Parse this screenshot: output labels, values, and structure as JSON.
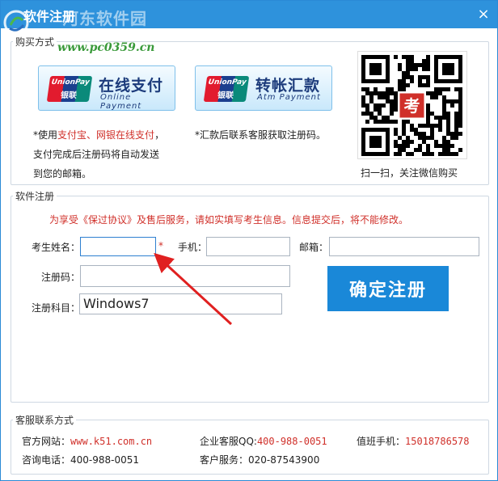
{
  "window": {
    "title": "软件注册",
    "watermark_name": "河东软件园",
    "watermark_url": "www.pc0359.cn",
    "close_glyph": "×"
  },
  "purchase": {
    "legend": "购买方式",
    "online_pay": {
      "brand_top": "UnionPay",
      "brand_bottom": "银联",
      "label": "在线支付",
      "sublabel": "Online Payment"
    },
    "atm_pay": {
      "brand_top": "UnionPay",
      "brand_bottom": "银联",
      "label": "转帐汇款",
      "sublabel": "Atm Payment"
    },
    "note1_prefix": "*使用",
    "note1_red1": "支付宝",
    "note1_sep": "、",
    "note1_red2": "网银在线支付",
    "note1_suffix": "，",
    "note1_line2": "支付完成后注册码将自动发送",
    "note1_line3": "到您的邮箱。",
    "note2": "*汇款后联系客服获取注册码。",
    "qr_caption": "扫一扫，关注微信购买",
    "qr_center_char": "考"
  },
  "register": {
    "legend": "软件注册",
    "notice": "为享受《保过协议》及售后服务，请如实填写考生信息。信息提交后，将不能修改。",
    "name_label": "考生姓名：",
    "name_value": "",
    "required_mark": "*",
    "phone_label": "手机：",
    "phone_value": "",
    "email_label": "邮箱：",
    "email_value": "",
    "code_label": "注册码：",
    "code_value": "",
    "course_label": "注册科目：",
    "course_value": "Windows7",
    "confirm_label": "确定注册"
  },
  "service": {
    "legend": "客服联系方式",
    "website_label": "官方网站：",
    "website_value": "www.k51.com.cn",
    "qq_label": "企业客服QQ:",
    "qq_value": "400-988-0051",
    "mobile_label": "值班手机：",
    "mobile_value": "15018786578",
    "phone_label": "咨询电话：",
    "phone_value": "400-988-0051",
    "service_label": "客户服务：",
    "service_value": "020-87543900"
  },
  "colors": {
    "titlebar": "#2e92dc",
    "confirm_button": "#1a88d8",
    "highlight_red": "#d0302a",
    "arrow_red": "#e02020"
  }
}
